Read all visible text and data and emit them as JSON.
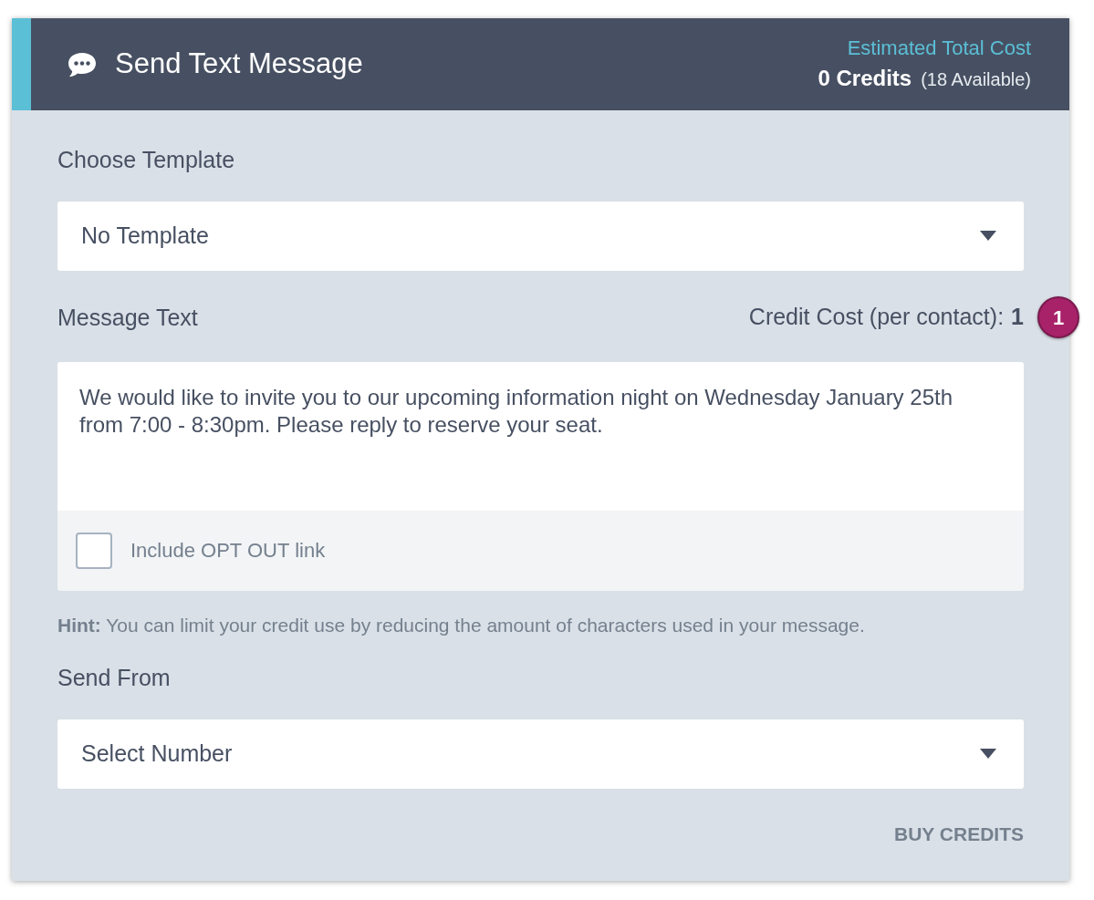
{
  "header": {
    "title": "Send Text Message",
    "cost_label": "Estimated Total Cost",
    "credits": "0 Credits",
    "available": "(18 Available)"
  },
  "template": {
    "label": "Choose Template",
    "value": "No Template"
  },
  "message": {
    "label": "Message Text",
    "cost_label": "Credit Cost (per contact):",
    "cost_value": "1",
    "badge": "1",
    "value": "We would like to invite you to our upcoming information night on Wednesday January 25th from 7:00 - 8:30pm. Please reply to reserve your seat.",
    "opt_out": {
      "label": "Include OPT OUT link",
      "checked": false
    }
  },
  "hint": "**Hint:** You can limit your credit use by reducing the amount of characters used in your message.",
  "send_from": {
    "label": "Send From",
    "value": "Select Number"
  },
  "buy_button": "BUY CREDITS"
}
